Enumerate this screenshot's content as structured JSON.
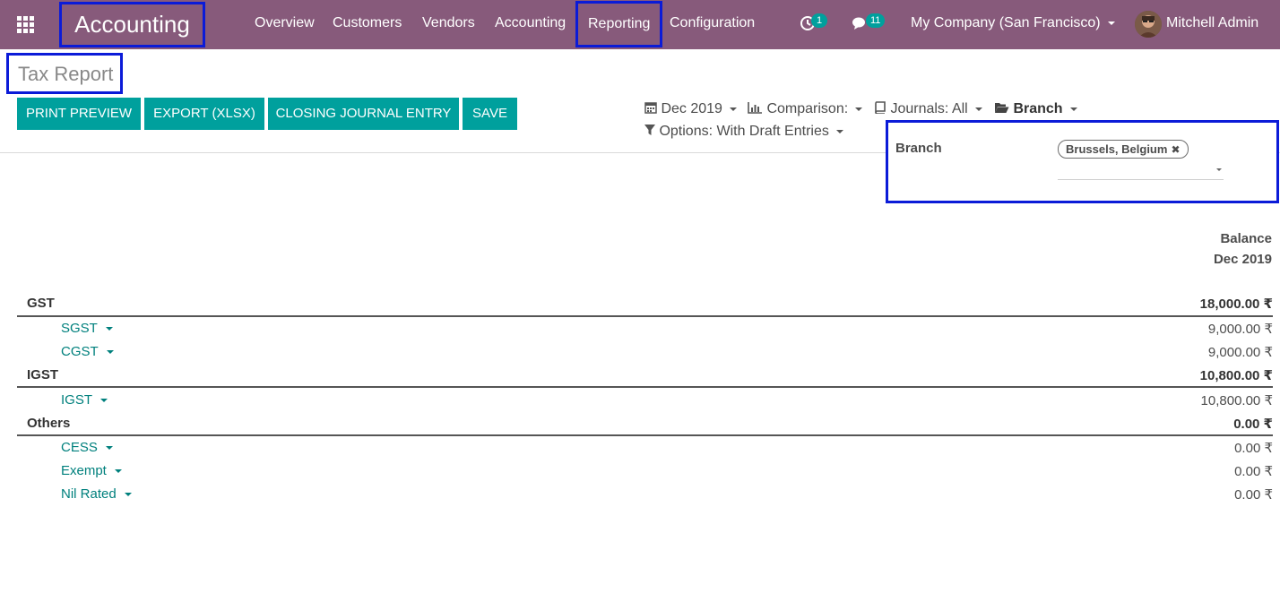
{
  "navbar": {
    "app_name": "Accounting",
    "menu": [
      "Overview",
      "Customers",
      "Vendors",
      "Accounting",
      "Reporting",
      "Configuration"
    ],
    "activity_count": "1",
    "messages_count": "11",
    "company": "My Company (San Francisco)",
    "user": "Mitchell Admin"
  },
  "page": {
    "title": "Tax Report",
    "buttons": {
      "print_preview": "PRINT PREVIEW",
      "export": "EXPORT (XLSX)",
      "closing_entry": "CLOSING JOURNAL ENTRY",
      "save": "SAVE"
    },
    "filters": {
      "date": "Dec 2019",
      "comparison": "Comparison:",
      "journals": "Journals: All",
      "branch": "Branch",
      "options": "Options: With Draft Entries"
    }
  },
  "branch_panel": {
    "label": "Branch",
    "selected_tag": "Brussels, Belgium"
  },
  "report": {
    "column_header_1": "Balance",
    "column_header_2": "Dec 2019",
    "sections": [
      {
        "name": "GST",
        "total": "18,000.00 ₹",
        "lines": [
          {
            "name": "SGST",
            "value": "9,000.00 ₹"
          },
          {
            "name": "CGST",
            "value": "9,000.00 ₹"
          }
        ]
      },
      {
        "name": "IGST",
        "total": "10,800.00 ₹",
        "lines": [
          {
            "name": "IGST",
            "value": "10,800.00 ₹"
          }
        ]
      },
      {
        "name": "Others",
        "total": "0.00 ₹",
        "lines": [
          {
            "name": "CESS",
            "value": "0.00 ₹"
          },
          {
            "name": "Exempt",
            "value": "0.00 ₹"
          },
          {
            "name": "Nil Rated",
            "value": "0.00 ₹"
          }
        ]
      }
    ]
  },
  "colors": {
    "navbar": "#875a7b",
    "accent": "#00a09d",
    "highlight_border": "#0b1bd8"
  }
}
